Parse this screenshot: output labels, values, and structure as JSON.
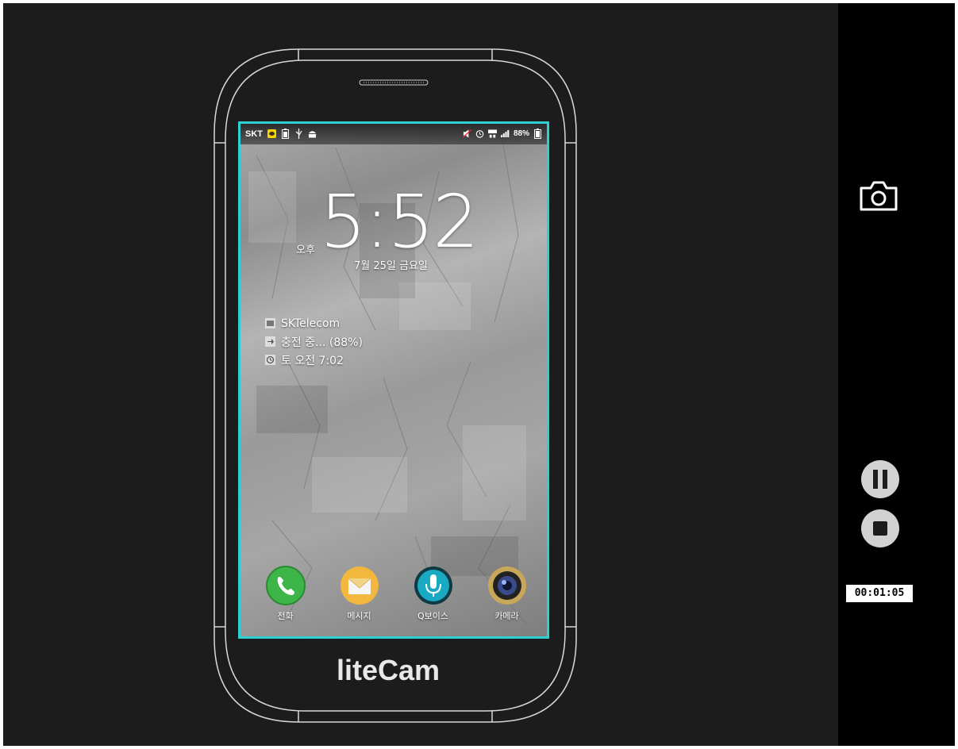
{
  "phone": {
    "status_bar": {
      "carrier": "SKT",
      "battery_percent": "88%"
    },
    "lockscreen": {
      "time": "5:52",
      "ampm": "오후",
      "date": "7월 25일 금요일",
      "info": [
        {
          "icon": "sim-card-icon",
          "text": "SKTelecom"
        },
        {
          "icon": "charging-icon",
          "text": "충전 중... (88%)"
        },
        {
          "icon": "alarm-icon",
          "text": "토 오전 7:02"
        }
      ]
    },
    "dock": [
      {
        "icon": "phone-icon",
        "label": "전화",
        "color": "#3db548"
      },
      {
        "icon": "message-icon",
        "label": "메시지",
        "color": "#f2b73c"
      },
      {
        "icon": "voice-icon",
        "label": "Q보이스",
        "color": "#1aa9c3"
      },
      {
        "icon": "camera-icon",
        "label": "카메라",
        "color": "#6d7aa8"
      }
    ],
    "brand": "liteCam",
    "screen_border_color": "#2ed0d2"
  },
  "controls": {
    "timer": "00:01:05"
  }
}
